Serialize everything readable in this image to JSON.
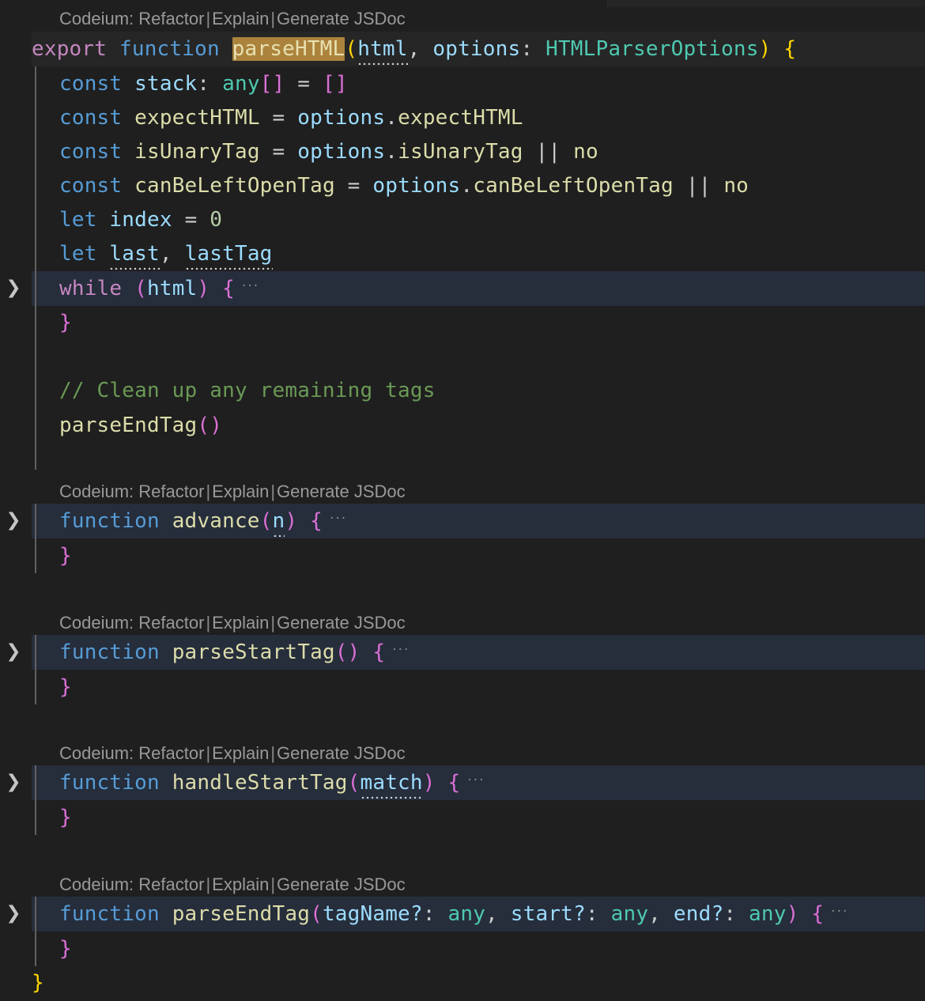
{
  "editor": {
    "theme": "dark-modern",
    "background": "#1f1f1f",
    "folded_line_background": "#262d3b",
    "sticky_line_background": "#262626",
    "selection_highlight": "#ab833c",
    "indent_guide_color": "#616161"
  },
  "codelens": {
    "prefix": "Codeium:",
    "actions": [
      "Refactor",
      "Explain",
      "Generate JSDoc"
    ],
    "separator": "|",
    "full_text": "Codeium: Refactor | Explain | Generate JSDoc"
  },
  "fold_marker": "···",
  "fold_chevron": "❯",
  "code": {
    "line1": {
      "export": "export",
      "function_kw": "function",
      "name_highlighted": "parseHTML",
      "paren_open": "(",
      "param1": "html",
      "comma": ", ",
      "param2": "options",
      "colon": ": ",
      "type": "HTMLParserOptions",
      "paren_close": ")",
      "brace": "{"
    },
    "line2": {
      "decl": "const",
      "name": "stack",
      "colon": ": ",
      "type": "any",
      "brackets": "[]",
      "eq": "=",
      "value": "[]"
    },
    "line3": {
      "decl": "const",
      "name": "expectHTML",
      "eq": "=",
      "object": "options",
      "dot": ".",
      "prop": "expectHTML"
    },
    "line4": {
      "decl": "const",
      "name": "isUnaryTag",
      "eq": "=",
      "object": "options",
      "dot": ".",
      "prop": "isUnaryTag",
      "or": "||",
      "fallback": "no"
    },
    "line5": {
      "decl": "const",
      "name": "canBeLeftOpenTag",
      "eq": "=",
      "object": "options",
      "dot": ".",
      "prop": "canBeLeftOpenTag",
      "or": "||",
      "fallback": "no"
    },
    "line6": {
      "decl": "let",
      "name": "index",
      "eq": "=",
      "value": "0"
    },
    "line7": {
      "decl": "let",
      "name1": "last",
      "comma": ", ",
      "name2": "lastTag"
    },
    "line8": {
      "kw": "while",
      "paren_open": "(",
      "cond": "html",
      "paren_close": ")",
      "brace": "{"
    },
    "line9": {
      "brace": "}"
    },
    "line10": {
      "comment": "// Clean up any remaining tags"
    },
    "line11": {
      "call": "parseEndTag",
      "parens": "()"
    },
    "fn_advance": {
      "kw": "function",
      "name": "advance",
      "paren_open": "(",
      "param": "n",
      "paren_close": ")",
      "brace": "{"
    },
    "fn_advance_close": {
      "brace": "}"
    },
    "fn_parseStartTag": {
      "kw": "function",
      "name": "parseStartTag",
      "parens": "()",
      "brace": "{"
    },
    "fn_parseStartTag_close": {
      "brace": "}"
    },
    "fn_handleStartTag": {
      "kw": "function",
      "name": "handleStartTag",
      "paren_open": "(",
      "param": "match",
      "paren_close": ")",
      "brace": "{"
    },
    "fn_handleStartTag_close": {
      "brace": "}"
    },
    "fn_parseEndTag": {
      "kw": "function",
      "name": "parseEndTag",
      "paren_open": "(",
      "param1": "tagName?",
      "colon1": ": ",
      "type1": "any",
      "comma1": ", ",
      "param2": "start?",
      "colon2": ": ",
      "type2": "any",
      "comma2": ", ",
      "param3": "end?",
      "colon3": ": ",
      "type3": "any",
      "paren_close": ")",
      "brace": "{"
    },
    "fn_parseEndTag_close": {
      "brace": "}"
    },
    "outer_close": {
      "brace": "}"
    }
  }
}
